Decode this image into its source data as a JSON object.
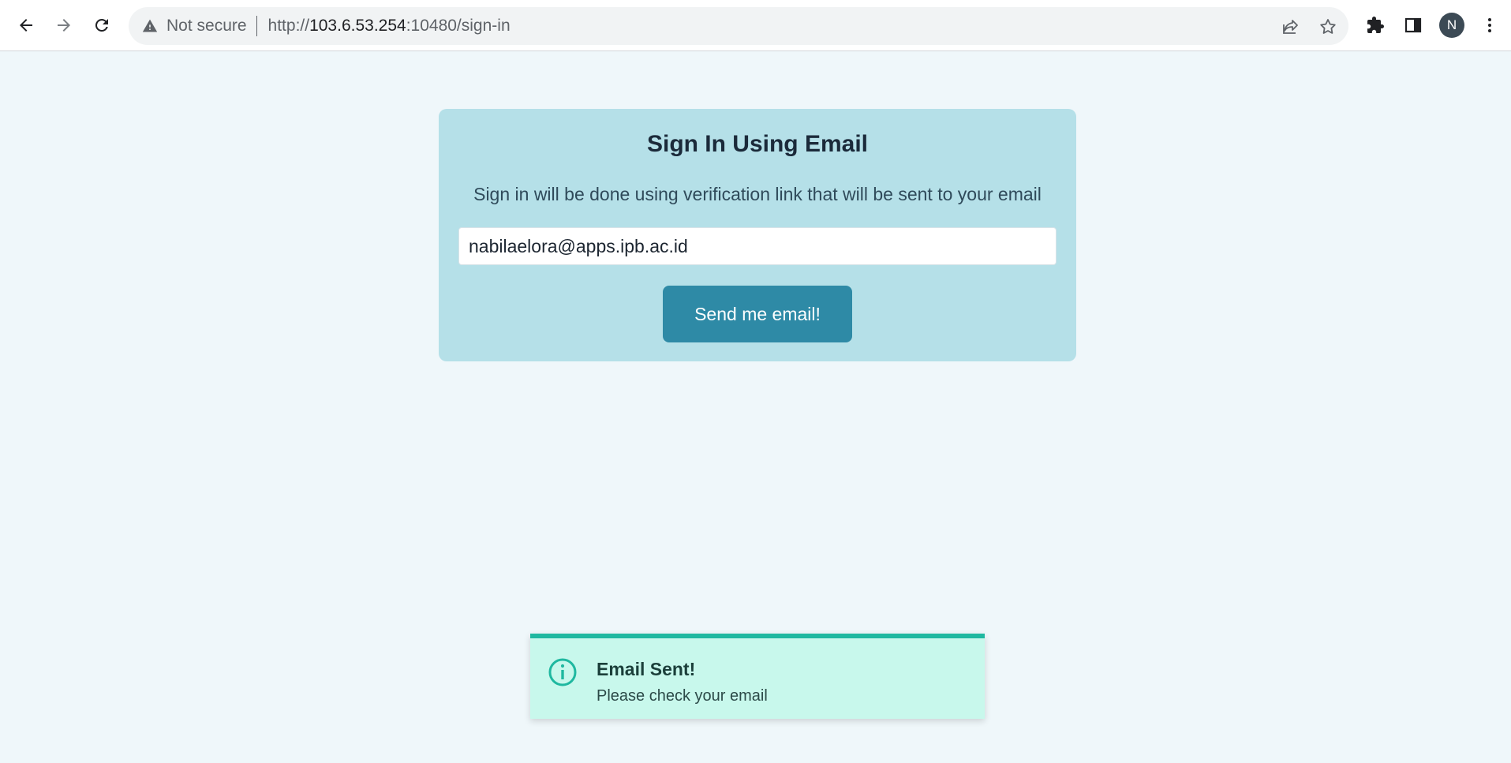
{
  "browser": {
    "security_label": "Not secure",
    "url_scheme": "http://",
    "url_host": "103.6.53.254",
    "url_rest": ":10480/sign-in",
    "profile_initial": "N"
  },
  "icons": {
    "back": "back-arrow-icon",
    "forward": "forward-arrow-icon",
    "reload": "reload-icon",
    "warning": "warning-triangle-icon",
    "share": "share-icon",
    "bookmark": "star-icon",
    "extensions": "puzzle-icon",
    "side_panel": "side-panel-icon",
    "menu": "kebab-menu-icon",
    "toast_info": "info-circle-icon"
  },
  "signin": {
    "title": "Sign In Using Email",
    "description": "Sign in will be done using verification link that will be sent to your email",
    "email_value": "nabilaelora@apps.ipb.ac.id",
    "send_label": "Send me email!"
  },
  "toast": {
    "title": "Email Sent!",
    "message": "Please check your email"
  },
  "colors": {
    "page_bg": "#eff7fa",
    "card_bg": "#b5e0e8",
    "button_bg": "#2e8aa6",
    "toast_bg": "#c8f8ec",
    "toast_accent": "#1fb8a0"
  }
}
